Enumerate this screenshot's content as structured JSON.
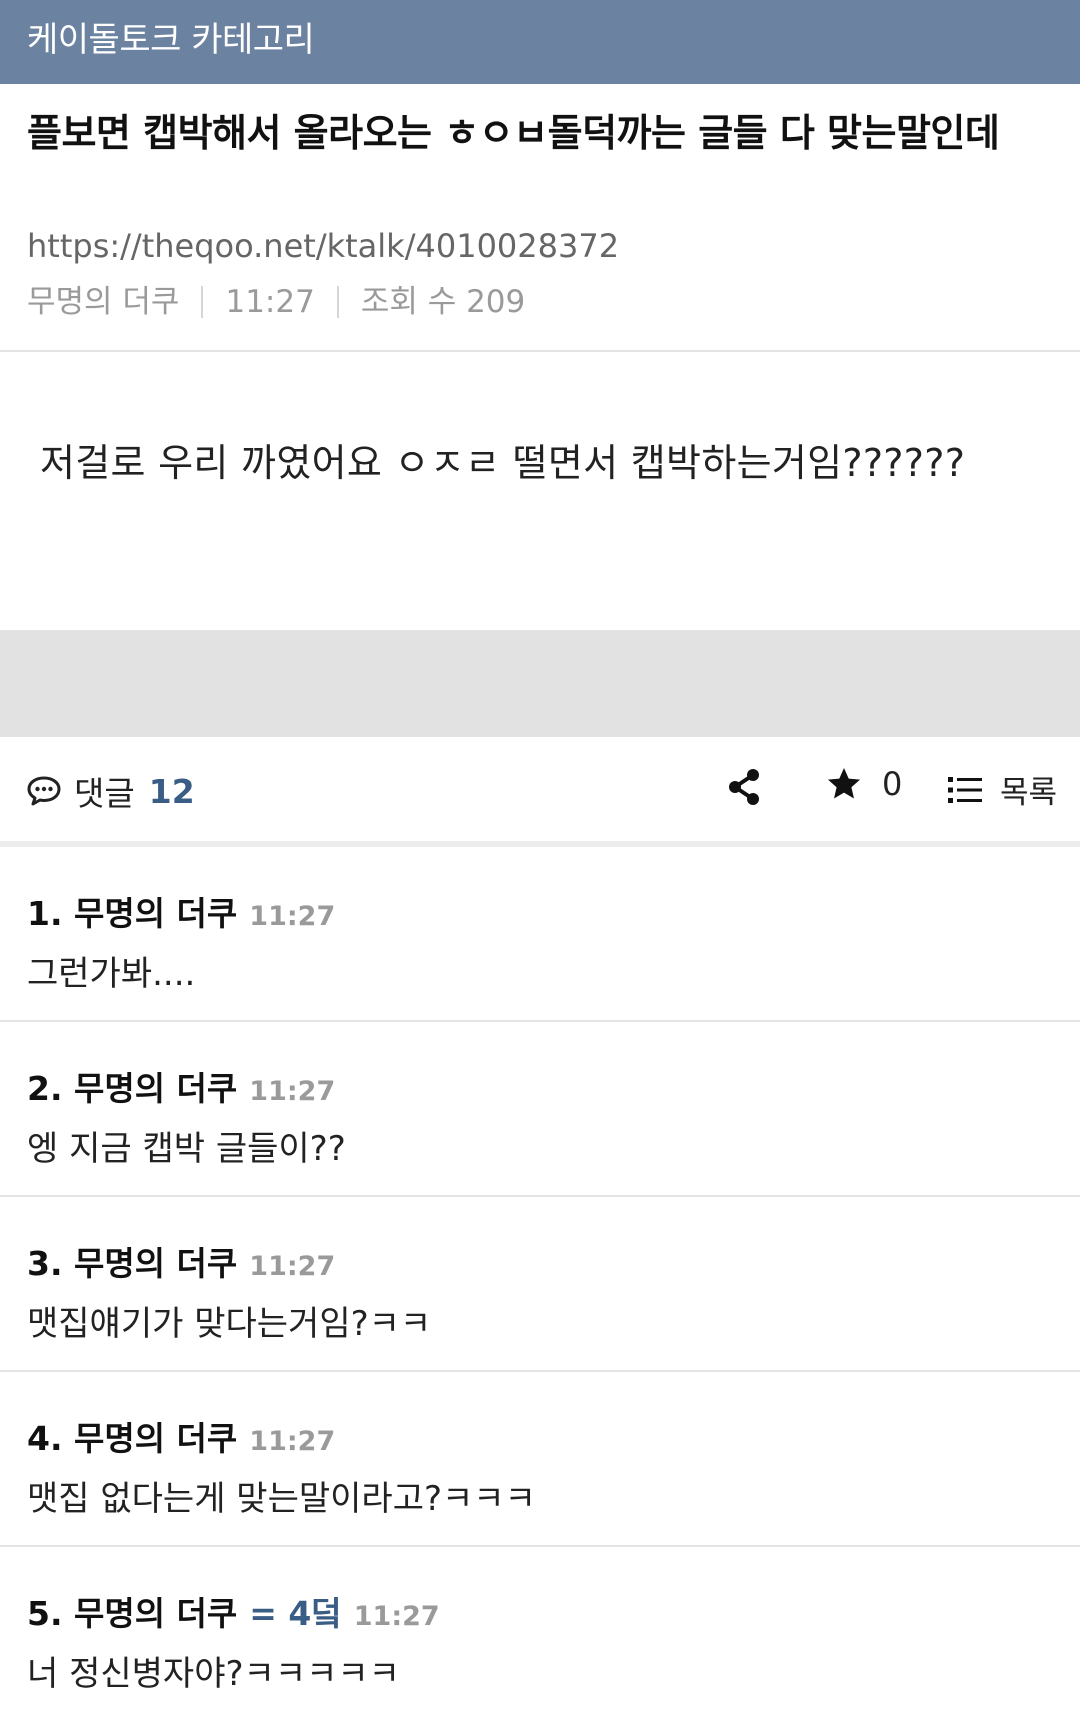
{
  "header": {
    "category": "케이돌토크 카테고리"
  },
  "post": {
    "title": "플보면 캡박해서 올라오는 ㅎㅇㅂ돌덕까는 글들 다 맞는말인데",
    "url": "https://theqoo.net/ktalk/4010028372",
    "author": "무명의 더쿠",
    "time": "11:27",
    "views": "조회 수 209",
    "body": "저걸로 우리 까였어요 ㅇㅈㄹ 떨면서 캡박하는거임??????"
  },
  "actions": {
    "comments_label": "댓글",
    "comments_count": "12",
    "star_count": "0",
    "list_label": "목록",
    "icons": [
      "comment-icon",
      "share-icon",
      "star-icon",
      "list-icon"
    ]
  },
  "comments": [
    {
      "author": "1. 무명의 더쿠",
      "tag": "",
      "time": "11:27",
      "text": "그런가봐...."
    },
    {
      "author": "2. 무명의 더쿠",
      "tag": "",
      "time": "11:27",
      "text": "엥 지금 캡박 글들이??"
    },
    {
      "author": "3. 무명의 더쿠",
      "tag": "",
      "time": "11:27",
      "text": "맷집얘기가 맞다는거임?ㅋㅋ"
    },
    {
      "author": "4. 무명의 더쿠",
      "tag": "",
      "time": "11:27",
      "text": "맷집 없다는게 맞는말이라고?ㅋㅋㅋ"
    },
    {
      "author": "5. 무명의 더쿠",
      "tag": "= 4덬",
      "time": "11:27",
      "text": "너 정신병자야?ㅋㅋㅋㅋㅋ"
    }
  ],
  "colors": {
    "header_bg": "#6b83a1",
    "accent": "#3a5d86"
  }
}
